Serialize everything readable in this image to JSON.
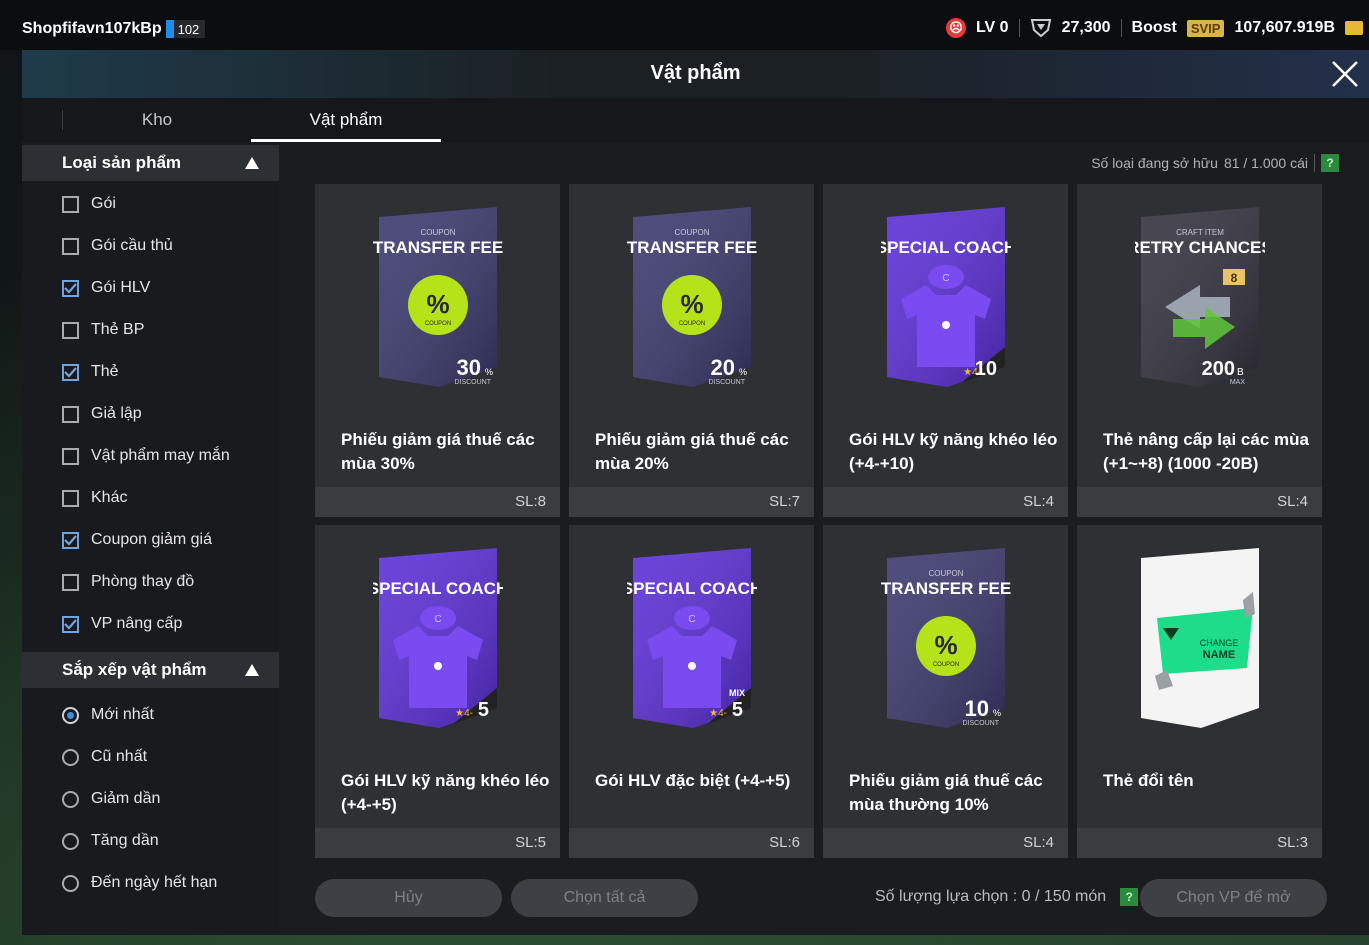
{
  "topbar": {
    "username": "Shopfifavn107kBp",
    "user_level": "102",
    "level_label": "LV 0",
    "shield_value": "27,300",
    "boost_label": "Boost",
    "svip_label": "SVIP",
    "currency_value": "107,607.919B"
  },
  "window": {
    "title": "Vật phẩm",
    "tabs": [
      {
        "label": "Kho",
        "active": false
      },
      {
        "label": "Vật phẩm",
        "active": true
      }
    ]
  },
  "filters": {
    "product_type_heading": "Loại sản phẩm",
    "product_types": [
      {
        "label": "Gói",
        "checked": false
      },
      {
        "label": "Gói cầu thủ",
        "checked": false
      },
      {
        "label": "Gói HLV",
        "checked": true
      },
      {
        "label": "Thẻ BP",
        "checked": false
      },
      {
        "label": "Thẻ",
        "checked": true
      },
      {
        "label": "Giả lập",
        "checked": false
      },
      {
        "label": "Vật phẩm may mắn",
        "checked": false
      },
      {
        "label": "Khác",
        "checked": false
      },
      {
        "label": "Coupon giảm giá",
        "checked": true
      },
      {
        "label": "Phòng thay đồ",
        "checked": false
      },
      {
        "label": "VP nâng cấp",
        "checked": true
      }
    ],
    "sort_heading": "Sắp xếp vật phẩm",
    "sort_options": [
      {
        "label": "Mới nhất",
        "selected": true
      },
      {
        "label": "Cũ nhất",
        "selected": false
      },
      {
        "label": "Giảm dần",
        "selected": false
      },
      {
        "label": "Tăng dần",
        "selected": false
      },
      {
        "label": "Đến ngày hết hạn",
        "selected": false
      }
    ]
  },
  "owned": {
    "label": "Số loại đang sở hữu",
    "value": "81 / 1.000 cái",
    "help": "?"
  },
  "items": [
    {
      "name": "Phiếu giảm giá thuế các mùa 30%",
      "qty": "SL:8",
      "art": "coupon",
      "art_top": "COUPON",
      "art_title": "TRANSFER FEE",
      "art_value": "30",
      "art_unit": "%",
      "art_sub": "DISCOUNT",
      "art_color": "#3b3a6e"
    },
    {
      "name": "Phiếu giảm giá thuế các mùa 20%",
      "qty": "SL:7",
      "art": "coupon",
      "art_top": "COUPON",
      "art_title": "TRANSFER FEE",
      "art_value": "20",
      "art_unit": "%",
      "art_sub": "DISCOUNT",
      "art_color": "#3b3a6e"
    },
    {
      "name": "Gói HLV kỹ năng khéo léo (+4-+10)",
      "qty": "SL:4",
      "art": "coach",
      "art_top": "",
      "art_title": "SPECIAL COACH",
      "art_value": "10",
      "art_unit": "★4-",
      "art_sub": "",
      "art_color": "#5b2fd6"
    },
    {
      "name": "Thẻ nâng cấp lại các mùa (+1~+8) (1000 -20B)",
      "qty": "SL:4",
      "art": "retry",
      "art_top": "CRAFT ITEM",
      "art_title": "RETRY CHANCES",
      "art_value": "200",
      "art_unit": "B",
      "art_sub": "MAX",
      "art_color": "#34323e"
    },
    {
      "name": "Gói HLV kỹ năng khéo léo (+4-+5)",
      "qty": "SL:5",
      "art": "coach",
      "art_top": "",
      "art_title": "SPECIAL COACH",
      "art_value": "5",
      "art_unit": "★4-",
      "art_sub": "",
      "art_color": "#5b2fd6"
    },
    {
      "name": "Gói HLV đặc biệt (+4-+5)",
      "qty": "SL:6",
      "art": "coach",
      "art_top": "MIX",
      "art_title": "SPECIAL COACH",
      "art_value": "5",
      "art_unit": "★4-",
      "art_sub": "",
      "art_color": "#5b2fd6"
    },
    {
      "name": "Phiếu giảm giá thuế các mùa thường 10%",
      "qty": "SL:4",
      "art": "coupon",
      "art_top": "COUPON",
      "art_title": "TRANSFER FEE",
      "art_value": "10",
      "art_unit": "%",
      "art_sub": "DISCOUNT",
      "art_color": "#3b3a6e"
    },
    {
      "name": "Thẻ đổi tên",
      "qty": "SL:3",
      "art": "rename",
      "art_top": "",
      "art_title": "CHANGE NAME",
      "art_value": "",
      "art_unit": "",
      "art_sub": "",
      "art_color": "#f2f2f2"
    }
  ],
  "footer": {
    "cancel_label": "Hủy",
    "select_all_label": "Chọn tất cả",
    "selection_label": "Số lượng lựa chọn : 0 / 150 món",
    "help": "?",
    "open_label": "Chọn VP để mở"
  }
}
